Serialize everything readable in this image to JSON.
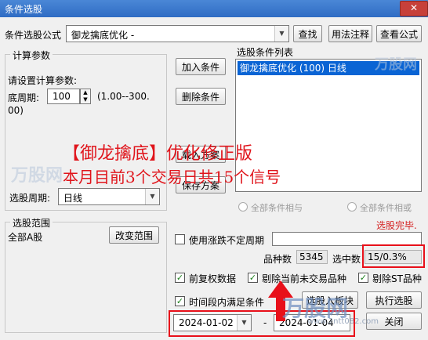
{
  "window": {
    "title": "条件选股",
    "close_glyph": "✕"
  },
  "formula": {
    "label": "条件选股公式",
    "value": "御龙擒底优化  -",
    "find_btn": "查找",
    "usage_btn": "用法注释",
    "view_btn": "查看公式"
  },
  "params": {
    "group_label": "计算参数",
    "prompt": "请设置计算参数:",
    "period_label": "底周期:",
    "period_value": "100",
    "range_text": "(1.00--300.",
    "range_text2": "00)"
  },
  "buttons": {
    "add": "加入条件",
    "delete": "删除条件",
    "load": "载入方案",
    "save": "保存方案"
  },
  "condition_list": {
    "label": "选股条件列表",
    "items": [
      "御龙擒底优化 (100) 日线"
    ]
  },
  "overlay": {
    "line1": "【御龙擒底】优化修正版",
    "line2": "本月目前3个交易日共15个信号"
  },
  "period_select": {
    "label": "选股周期:",
    "value": "日线"
  },
  "logic": {
    "and_label": "全部条件相与",
    "or_label": "全部条件相或"
  },
  "status": {
    "done": "选股完毕."
  },
  "scope": {
    "group_label": "选股范围",
    "value": "全部A股",
    "change_btn": "改变范围"
  },
  "uncertain_period": {
    "label": "使用涨跌不定周期"
  },
  "stats": {
    "count_label": "品种数",
    "count_value": "5345",
    "selected_label": "选中数",
    "selected_value": "15/0.3%"
  },
  "options": {
    "fq": "前复权数据",
    "exclude_untraded": "剔除当前未交易品种",
    "exclude_st": "剔除ST品种",
    "time_range": "时间段内满足条件"
  },
  "actions": {
    "to_block": "选股入板块",
    "run": "执行选股",
    "close": "关闭"
  },
  "dates": {
    "start": "2024-01-02",
    "separator": "-",
    "end": "2024-01-04"
  },
  "watermarks": {
    "brand": "万股网",
    "site": "www.2ntt082.com"
  },
  "colors": {
    "overlay_red": "#e0141b",
    "status_red": "#d42020",
    "highlight_red": "#e8101a",
    "selected_bg": "#0a64d4",
    "titlebar": "#2f6cc4"
  }
}
